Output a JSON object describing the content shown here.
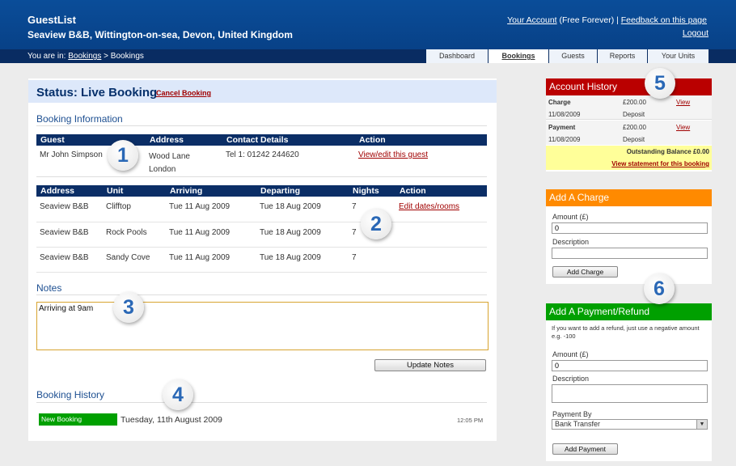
{
  "header": {
    "app_name": "GuestList",
    "property": "Seaview B&B, Wittington-on-sea, Devon, United Kingdom",
    "your_account": "Your Account",
    "plan": " (Free Forever) | ",
    "feedback": "Feedback on this page",
    "logout": "Logout"
  },
  "nav": {
    "crumb_prefix": "You are in: ",
    "crumb_link": "Bookings",
    "crumb_sep": " > ",
    "crumb_current": "Bookings",
    "tabs": [
      "Dashboard",
      "Bookings",
      "Guests",
      "Reports",
      "Your Units"
    ]
  },
  "status": {
    "title": "Status: Live Booking",
    "cancel": "Cancel Booking"
  },
  "booking_info": {
    "heading": "Booking Information",
    "headers": [
      "Guest",
      "Address",
      "Contact Details",
      "Action"
    ],
    "guest": "Mr John Simpson",
    "address_1": "Wood Lane",
    "address_2": "London",
    "contact": "Tel 1: 01242 244620",
    "action": "View/edit this guest"
  },
  "units": {
    "headers": [
      "Address",
      "Unit",
      "Arriving",
      "Departing",
      "Nights",
      "Action"
    ],
    "rows": [
      {
        "address": "Seaview B&B",
        "unit": "Clifftop",
        "arriving": "Tue 11 Aug 2009",
        "departing": "Tue 18 Aug 2009",
        "nights": "7"
      },
      {
        "address": "Seaview B&B",
        "unit": "Rock Pools",
        "arriving": "Tue 11 Aug 2009",
        "departing": "Tue 18 Aug 2009",
        "nights": "7"
      },
      {
        "address": "Seaview B&B",
        "unit": "Sandy Cove",
        "arriving": "Tue 11 Aug 2009",
        "departing": "Tue 18 Aug 2009",
        "nights": "7"
      }
    ],
    "action": "Edit dates/rooms"
  },
  "notes": {
    "heading": "Notes",
    "value": "Arriving at 9am",
    "button": "Update Notes"
  },
  "history": {
    "heading": "Booking History",
    "tag": "New Booking",
    "date": "Tuesday, 11th August 2009",
    "time": "12:05 PM"
  },
  "account_history": {
    "title": "Account History",
    "entries": [
      {
        "type": "Charge",
        "amount": "£200.00",
        "link": "View",
        "date": "11/08/2009",
        "desc": "Deposit"
      },
      {
        "type": "Payment",
        "amount": "£200.00",
        "link": "View",
        "date": "11/08/2009",
        "desc": "Deposit"
      }
    ],
    "balance": "Outstanding Balance £0.00",
    "statement": "View statement for this booking"
  },
  "add_charge": {
    "title": "Add A Charge",
    "amount_label": "Amount (£)",
    "amount": "0",
    "desc_label": "Description",
    "button": "Add Charge"
  },
  "add_payment": {
    "title": "Add A Payment/Refund",
    "hint": "If you want to add a refund, just use a negative amount e.g. -100",
    "amount_label": "Amount (£)",
    "amount": "0",
    "desc_label": "Description",
    "method_label": "Payment By",
    "method": "Bank Transfer",
    "button": "Add Payment"
  },
  "callouts": [
    "1",
    "2",
    "3",
    "4",
    "5",
    "6"
  ],
  "colors": {
    "header": "#0a4d99",
    "nav": "#092c62",
    "accent_red": "#ba0000",
    "orange": "#ff8a00",
    "green": "#00a000"
  }
}
